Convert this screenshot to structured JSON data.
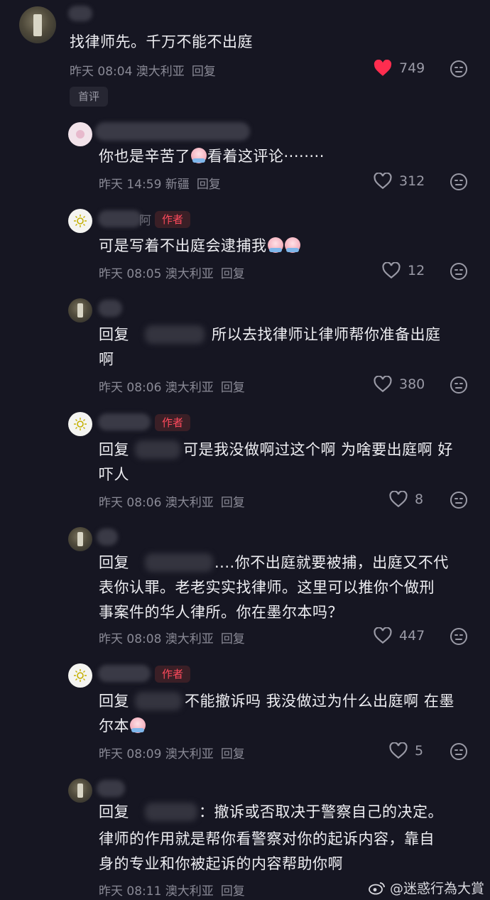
{
  "top_comment": {
    "text": "找律师先。千万不能不出庭",
    "meta": "昨天 08:04 澳大利亚",
    "reply_label": "回复",
    "likes": "749",
    "liked": true,
    "first_tag": "首评"
  },
  "replies": [
    {
      "id": "r1",
      "avatar": "pink",
      "author_badge": "",
      "text_parts": [
        "你也是辛苦了",
        "看着这评论········"
      ],
      "emoji_count": 1,
      "meta": "昨天 14:59 新疆",
      "reply_label": "回复",
      "likes": "312"
    },
    {
      "id": "r2",
      "avatar": "sun",
      "author_badge": "作者",
      "name_suffix": "阿",
      "text": "可是写着不出庭会逮捕我",
      "emoji_count": 2,
      "meta": "昨天 08:05 澳大利亚",
      "reply_label": "回复",
      "likes": "12"
    },
    {
      "id": "r3",
      "avatar": "photo",
      "author_badge": "",
      "reply_prefix": "回复",
      "line1": "所以去找律师让律师帮你准备出庭",
      "line2": "啊",
      "meta": "昨天 08:06 澳大利亚",
      "reply_label": "回复",
      "likes": "380"
    },
    {
      "id": "r4",
      "avatar": "sun",
      "author_badge": "作者",
      "reply_prefix": "回复",
      "line1": "可是我没做啊过这个啊 为啥要出庭啊 好",
      "line2": "吓人",
      "meta": "昨天 08:06 澳大利亚",
      "reply_label": "回复",
      "likes": "8"
    },
    {
      "id": "r5",
      "avatar": "photo",
      "author_badge": "",
      "reply_prefix": "回复",
      "line1": "....你不出庭就要被捕，出庭又不代",
      "line2": "表你认罪。老老实实找律师。这里可以推你个做刑",
      "line3": "事案件的华人律所。你在墨尔本吗？",
      "meta": "昨天 08:08 澳大利亚",
      "reply_label": "回复",
      "likes": "447"
    },
    {
      "id": "r6",
      "avatar": "sun",
      "author_badge": "作者",
      "reply_prefix": "回复",
      "line1": "不能撤诉吗 我没做过为什么出庭啊 在墨",
      "line2": "尔本",
      "meta": "昨天 08:09 澳大利亚",
      "reply_label": "回复",
      "likes": "5"
    },
    {
      "id": "r7",
      "avatar": "photo",
      "author_badge": "",
      "reply_prefix": "回复",
      "line1": "：撤诉或否取决于警察自己的决定。",
      "line2": "律师的作用就是帮你看警察对你的起诉内容，靠自",
      "line3": "身的专业和你被起诉的内容帮助你啊",
      "meta": "昨天 08:11 澳大利亚",
      "reply_label": "回复"
    }
  ],
  "watermark": "@迷惑行為大賞",
  "colors": {
    "background": "#161622",
    "author_badge": "#ff4a5c",
    "like_red": "#ff2d4f"
  }
}
